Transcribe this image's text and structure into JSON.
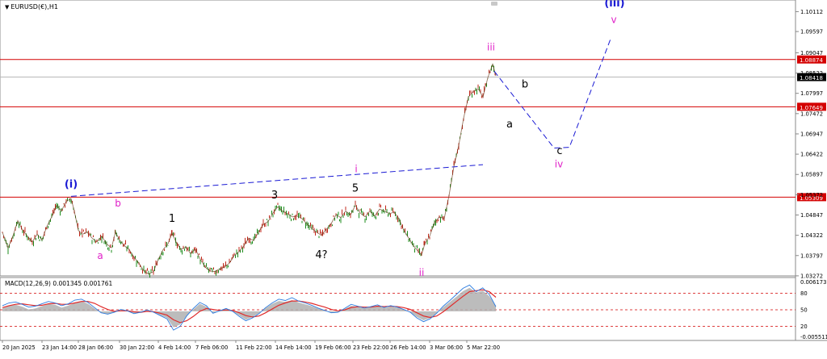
{
  "chart_data": [
    {
      "type": "line",
      "symbol": "EURUSD(€),H1",
      "ylim": [
        1.0327,
        1.1033
      ],
      "price_axis_ticks": [
        "1.10112",
        "1.09597",
        "1.09047",
        "1.08522",
        "1.07997",
        "1.07472",
        "1.06947",
        "1.06422",
        "1.05897",
        "1.05372",
        "1.04847",
        "1.04322",
        "1.03797",
        "1.03272"
      ],
      "x_tick_labels": [
        "20 Jan 2025",
        "23 Jan 14:00",
        "28 Jan 06:00",
        "30 Jan 22:00",
        "4 Feb 14:00",
        "7 Feb 06:00",
        "11 Feb 22:00",
        "14 Feb 14:00",
        "19 Feb 06:00",
        "23 Feb 22:00",
        "26 Feb 14:00",
        "3 Mar 06:00",
        "5 Mar 22:00"
      ],
      "horizontal_levels": [
        {
          "value": 1.08874,
          "label": "1.08874",
          "color": "#d40000"
        },
        {
          "value": 1.07649,
          "label": "1.07649",
          "color": "#d40000"
        },
        {
          "value": 1.05309,
          "label": "1.05309",
          "color": "#d40000"
        }
      ],
      "current_price": {
        "value": 1.08418,
        "label": "1.08418"
      },
      "wave_labels": [
        {
          "text": "(i)",
          "x_index": 88,
          "y": 1.0556,
          "color": "#1a1ad4"
        },
        {
          "text": "(iii)",
          "x_index": 761,
          "y": 1.1025,
          "color": "#1a1ad4"
        },
        {
          "text": "a",
          "x_index": 124,
          "y": 1.0371,
          "color": "#e020c8"
        },
        {
          "text": "b",
          "x_index": 146,
          "y": 1.0507,
          "color": "#e020c8"
        },
        {
          "text": "i",
          "x_index": 441,
          "y": 1.0595,
          "color": "#e020c8"
        },
        {
          "text": "ii",
          "x_index": 522,
          "y": 1.0327,
          "color": "#e020c8"
        },
        {
          "text": "iii",
          "x_index": 608,
          "y": 1.0911,
          "color": "#e020c8"
        },
        {
          "text": "iv",
          "x_index": 692,
          "y": 1.0608,
          "color": "#e020c8"
        },
        {
          "text": "v",
          "x_index": 760,
          "y": 1.0982,
          "color": "#e020c8"
        },
        {
          "text": "1",
          "x_index": 213,
          "y": 1.0467,
          "color": "#000000"
        },
        {
          "text": "3",
          "x_index": 340,
          "y": 1.0527,
          "color": "#000000"
        },
        {
          "text": "5",
          "x_index": 440,
          "y": 1.0545,
          "color": "#000000"
        },
        {
          "text": "4?",
          "x_index": 398,
          "y": 1.0373,
          "color": "#000000"
        },
        {
          "text": "a",
          "x_index": 631,
          "y": 1.0711,
          "color": "#000000"
        },
        {
          "text": "b",
          "x_index": 650,
          "y": 1.0815,
          "color": "#000000"
        },
        {
          "text": "c",
          "x_index": 693,
          "y": 1.0642,
          "color": "#000000"
        }
      ],
      "projection_lines": [
        {
          "points": [
            [
              88,
              1.0533
            ],
            [
              598,
              1.0615
            ]
          ],
          "color": "#1a1ad4",
          "dash": true
        },
        {
          "points": [
            [
              612,
              1.0857
            ],
            [
              686,
              1.0658
            ],
            [
              705,
              1.066
            ],
            [
              757,
              1.0946
            ]
          ],
          "color": "#1a1ad4",
          "dash": true
        }
      ],
      "price_path": [
        [
          3,
          1.044
        ],
        [
          10,
          1.04
        ],
        [
          16,
          1.043
        ],
        [
          22,
          1.047
        ],
        [
          28,
          1.0445
        ],
        [
          34,
          1.043
        ],
        [
          40,
          1.0415
        ],
        [
          46,
          1.0435
        ],
        [
          52,
          1.042
        ],
        [
          58,
          1.0455
        ],
        [
          64,
          1.048
        ],
        [
          70,
          1.051
        ],
        [
          76,
          1.0495
        ],
        [
          82,
          1.052
        ],
        [
          88,
          1.0527
        ],
        [
          92,
          1.0495
        ],
        [
          97,
          1.0445
        ],
        [
          102,
          1.0435
        ],
        [
          108,
          1.044
        ],
        [
          114,
          1.0425
        ],
        [
          120,
          1.0415
        ],
        [
          126,
          1.043
        ],
        [
          132,
          1.041
        ],
        [
          138,
          1.04
        ],
        [
          143,
          1.044
        ],
        [
          148,
          1.042
        ],
        [
          154,
          1.0405
        ],
        [
          160,
          1.0395
        ],
        [
          166,
          1.0375
        ],
        [
          172,
          1.036
        ],
        [
          178,
          1.034
        ],
        [
          184,
          1.0332
        ],
        [
          190,
          1.0338
        ],
        [
          196,
          1.037
        ],
        [
          202,
          1.0395
        ],
        [
          208,
          1.041
        ],
        [
          213,
          1.0438
        ],
        [
          218,
          1.0415
        ],
        [
          224,
          1.0395
        ],
        [
          230,
          1.0402
        ],
        [
          236,
          1.0385
        ],
        [
          242,
          1.0396
        ],
        [
          248,
          1.037
        ],
        [
          254,
          1.035
        ],
        [
          260,
          1.034
        ],
        [
          266,
          1.0338
        ],
        [
          272,
          1.0345
        ],
        [
          278,
          1.035
        ],
        [
          284,
          1.036
        ],
        [
          290,
          1.038
        ],
        [
          296,
          1.039
        ],
        [
          302,
          1.0405
        ],
        [
          308,
          1.0425
        ],
        [
          314,
          1.0418
        ],
        [
          320,
          1.044
        ],
        [
          326,
          1.046
        ],
        [
          332,
          1.0468
        ],
        [
          338,
          1.049
        ],
        [
          344,
          1.0506
        ],
        [
          350,
          1.0495
        ],
        [
          356,
          1.0488
        ],
        [
          362,
          1.048
        ],
        [
          368,
          1.0482
        ],
        [
          374,
          1.0475
        ],
        [
          380,
          1.0462
        ],
        [
          386,
          1.045
        ],
        [
          392,
          1.044
        ],
        [
          398,
          1.0432
        ],
        [
          404,
          1.0448
        ],
        [
          410,
          1.0462
        ],
        [
          416,
          1.0485
        ],
        [
          422,
          1.0478
        ],
        [
          428,
          1.0495
        ],
        [
          434,
          1.0485
        ],
        [
          440,
          1.051
        ],
        [
          446,
          1.049
        ],
        [
          452,
          1.048
        ],
        [
          458,
          1.0495
        ],
        [
          464,
          1.0482
        ],
        [
          470,
          1.05
        ],
        [
          476,
          1.0495
        ],
        [
          482,
          1.0488
        ],
        [
          488,
          1.0492
        ],
        [
          494,
          1.0475
        ],
        [
          500,
          1.0445
        ],
        [
          506,
          1.0425
        ],
        [
          512,
          1.0405
        ],
        [
          518,
          1.039
        ],
        [
          522,
          1.0382
        ],
        [
          526,
          1.041
        ],
        [
          532,
          1.043
        ],
        [
          538,
          1.0465
        ],
        [
          544,
          1.048
        ],
        [
          550,
          1.0475
        ],
        [
          556,
          1.0535
        ],
        [
          562,
          1.061
        ],
        [
          568,
          1.0665
        ],
        [
          574,
          1.0735
        ],
        [
          580,
          1.079
        ],
        [
          586,
          1.0805
        ],
        [
          592,
          1.0812
        ],
        [
          598,
          1.079
        ],
        [
          604,
          1.084
        ],
        [
          610,
          1.0875
        ],
        [
          614,
          1.0845
        ]
      ]
    },
    {
      "type": "line",
      "title": "MACD(12,26,9) 0.001345 0.001761",
      "ylim": [
        -0.005511,
        0.006173
      ],
      "axis_labels": [
        "0.006173",
        "80",
        "50",
        "20",
        "-0.005511"
      ],
      "dashed_levels": [
        80,
        50,
        20
      ],
      "series": [
        {
          "color": "#2a7be0",
          "values": [
            0.0012,
            0.0018,
            0.002,
            0.0015,
            0.0009,
            0.0011,
            0.0016,
            0.0021,
            0.0018,
            0.0012,
            0.0016,
            0.0024,
            0.0026,
            0.0019,
            0.0008,
            -0.0003,
            -0.0006,
            -0.0002,
            0.0004,
            0.0001,
            -0.0005,
            -0.0002,
            0.0003,
            -0.0002,
            -0.0009,
            -0.0016,
            -0.004,
            -0.0032,
            -0.001,
            0.0006,
            0.0019,
            0.0012,
            -0.0004,
            0.0001,
            0.0006,
            0.0,
            -0.0011,
            -0.002,
            -0.0014,
            -0.0005,
            0.0008,
            0.0018,
            0.0026,
            0.0023,
            0.0029,
            0.0022,
            0.0018,
            0.0013,
            0.0007,
            0.0002,
            -0.0003,
            -0.0002,
            0.0006,
            0.0015,
            0.0011,
            0.0007,
            0.001,
            0.0014,
            0.0008,
            0.0012,
            0.0009,
            0.0004,
            -0.0002,
            -0.0014,
            -0.0022,
            -0.0016,
            -0.0004,
            0.0011,
            0.0023,
            0.0036,
            0.0049,
            0.0056,
            0.0042,
            0.005,
            0.0036,
            0.001
          ]
        },
        {
          "color": "#e02a2a",
          "values": [
            0.0008,
            0.0012,
            0.0015,
            0.0016,
            0.0014,
            0.0012,
            0.0013,
            0.0016,
            0.0017,
            0.0015,
            0.0015,
            0.0018,
            0.0021,
            0.0021,
            0.0017,
            0.001,
            0.0004,
            0.0,
            0.0001,
            0.0001,
            -0.0001,
            -0.0002,
            0.0,
            -0.0001,
            -0.0004,
            -0.0008,
            -0.0018,
            -0.0024,
            -0.002,
            -0.0011,
            0.0,
            0.0006,
            0.0004,
            0.0002,
            0.0003,
            0.0002,
            -0.0003,
            -0.0009,
            -0.0012,
            -0.001,
            -0.0003,
            0.0005,
            0.0013,
            0.0018,
            0.0022,
            0.0022,
            0.002,
            0.0017,
            0.0013,
            0.0009,
            0.0004,
            0.0001,
            0.0003,
            0.0008,
            0.001,
            0.0009,
            0.0009,
            0.0011,
            0.001,
            0.0011,
            0.001,
            0.0008,
            0.0004,
            -0.0003,
            -0.001,
            -0.0013,
            -0.001,
            -0.0001,
            0.001,
            0.0021,
            0.0032,
            0.0042,
            0.0044,
            0.0046,
            0.0042,
            0.003
          ]
        },
        {
          "color": "#b0b0b0",
          "values": [
            0.0006,
            0.0012,
            0.0014,
            0.001,
            0.0004,
            0.0006,
            0.0011,
            0.0016,
            0.0014,
            0.0008,
            0.0012,
            0.0018,
            0.0022,
            0.0016,
            0.0006,
            -0.0003,
            -0.0006,
            -0.0002,
            0.0003,
            0.0001,
            -0.0004,
            -0.0002,
            0.0002,
            -0.0001,
            -0.0008,
            -0.0014,
            -0.0034,
            -0.0028,
            -0.0009,
            0.0004,
            0.0016,
            0.001,
            -0.0003,
            0.0001,
            0.0005,
            0.0,
            -0.0009,
            -0.0018,
            -0.0012,
            -0.0004,
            0.0007,
            0.0016,
            0.0022,
            0.002,
            0.0024,
            0.0019,
            0.0015,
            0.0011,
            0.0006,
            0.0002,
            -0.0003,
            -0.0001,
            0.0005,
            0.0012,
            0.001,
            0.0006,
            0.0009,
            0.0012,
            0.0007,
            0.001,
            0.0008,
            0.0004,
            -0.0002,
            -0.0012,
            -0.0019,
            -0.0014,
            -0.0004,
            0.0009,
            0.002,
            0.0031,
            0.0043,
            0.005,
            0.004,
            0.0044,
            0.0032,
            0.0012
          ]
        }
      ]
    }
  ],
  "ui": {
    "symbol_label": "EURUSD(€),H1",
    "macd_label": "MACD(12,26,9) 0.001345 0.001761"
  }
}
